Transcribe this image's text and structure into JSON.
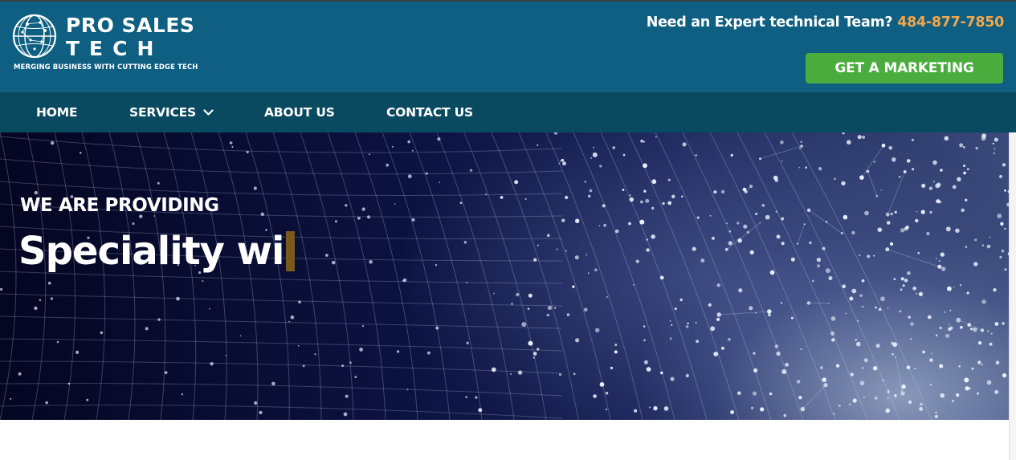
{
  "brand": {
    "name_line1": "PRO SALES",
    "name_line2": "TECH",
    "tagline": "MERGING BUSINESS WITH CUTTING EDGE TECH",
    "logo_icon": "globe-icon"
  },
  "header": {
    "contact_prompt": "Need an Expert technical Team?",
    "phone": "484-877-7850",
    "cta_label": "GET A MARKETING"
  },
  "nav": {
    "items": [
      {
        "label": "HOME"
      },
      {
        "label": "SERVICES",
        "icon": "chevron-down-icon"
      },
      {
        "label": "ABOUT US"
      },
      {
        "label": "CONTACT US"
      }
    ]
  },
  "hero": {
    "kicker": "WE ARE PROVIDING",
    "headline": "Speciality wi"
  },
  "colors": {
    "header_bg": "#0e5f82",
    "nav_bg": "#0a4a60",
    "phone": "#f2a64a",
    "cta_bg": "#4aac3c",
    "typing_cursor": "#7a5a1c"
  }
}
